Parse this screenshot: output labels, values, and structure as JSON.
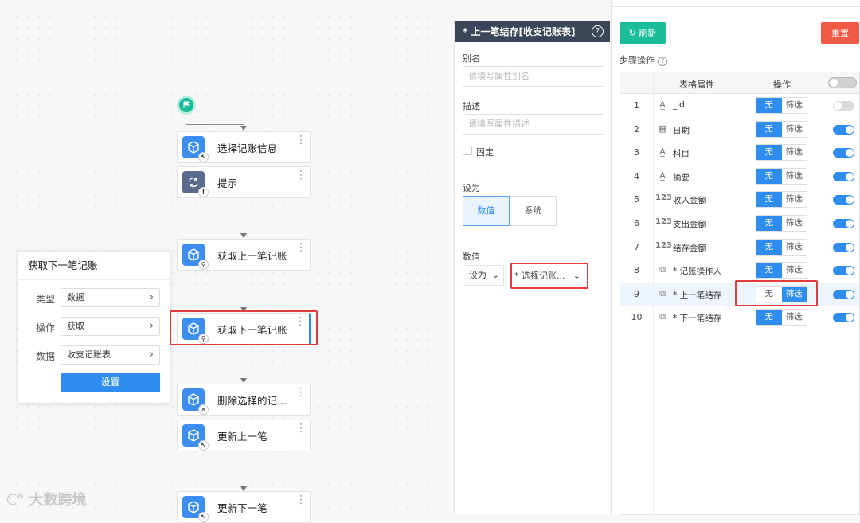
{
  "flow": {
    "steps": [
      {
        "label": "选择记账信息",
        "icon": "cube-icon",
        "badge": "cursor-badge"
      },
      {
        "label": "提示",
        "icon": "sync-icon",
        "badge": "alert-badge"
      },
      {
        "label": "获取上一笔记账",
        "icon": "cube-icon",
        "badge": "search-badge"
      },
      {
        "label": "获取下一笔记账",
        "icon": "cube-icon",
        "badge": "search-badge"
      },
      {
        "label": "删除选择的记...",
        "icon": "cube-icon",
        "badge": "delete-badge"
      },
      {
        "label": "更新上一笔",
        "icon": "cube-icon",
        "badge": "cursor-badge"
      },
      {
        "label": "更新下一笔",
        "icon": "cube-icon",
        "badge": "cursor-badge"
      }
    ]
  },
  "popup": {
    "title": "获取下一笔记账",
    "rows": [
      {
        "label": "类型",
        "value": "数据"
      },
      {
        "label": "操作",
        "value": "获取"
      },
      {
        "label": "数据",
        "value": "收支记账表"
      }
    ],
    "button": "设置"
  },
  "watermark": "大数跨境",
  "props": {
    "title": "* 上一笔结存[收支记账表]",
    "help": "?",
    "alias_label": "别名",
    "alias_placeholder": "请填写属性别名",
    "desc_label": "描述",
    "desc_placeholder": "请填写属性描述",
    "fixed_label": "固定",
    "setas_label": "设为",
    "seg_value": "数值",
    "seg_system": "系统",
    "value_label": "数值",
    "setas_select": "设为",
    "value_select": "* 选择记账..."
  },
  "right": {
    "refresh": "刷新",
    "reset": "重置",
    "step_ops": "步骤操作",
    "col_prop": "表格属性",
    "col_op": "操作",
    "op_none": "无",
    "op_filter": "筛选",
    "rows": [
      {
        "n": "1",
        "icon": "A",
        "name": "_id",
        "filter": false,
        "enabled": false
      },
      {
        "n": "2",
        "icon": "cal",
        "name": "日期",
        "filter": false,
        "enabled": true
      },
      {
        "n": "3",
        "icon": "A",
        "name": "科目",
        "filter": false,
        "enabled": true
      },
      {
        "n": "4",
        "icon": "A",
        "name": "摘要",
        "filter": false,
        "enabled": true
      },
      {
        "n": "5",
        "icon": "123",
        "name": "收入金额",
        "filter": false,
        "enabled": true
      },
      {
        "n": "6",
        "icon": "123",
        "name": "支出金额",
        "filter": false,
        "enabled": true
      },
      {
        "n": "7",
        "icon": "123",
        "name": "结存金额",
        "filter": false,
        "enabled": true
      },
      {
        "n": "8",
        "icon": "link",
        "name": "* 记账操作人",
        "filter": false,
        "enabled": true
      },
      {
        "n": "9",
        "icon": "link",
        "name": "* 上一笔结存",
        "filter": true,
        "enabled": true
      },
      {
        "n": "10",
        "icon": "link",
        "name": "* 下一笔结存",
        "filter": false,
        "enabled": true
      }
    ]
  },
  "colors": {
    "primary": "#2f8cf0",
    "teal": "#1bbc9b",
    "danger": "#f05a44",
    "header": "#3b4659",
    "highlight": "#e23b3b"
  }
}
